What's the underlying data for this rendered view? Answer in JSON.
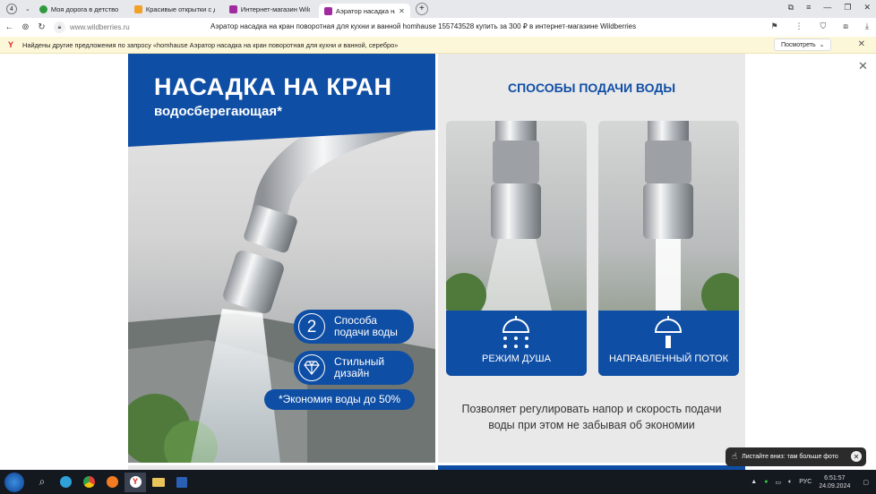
{
  "colors": {
    "brand_blue": "#0f4ea5",
    "tab_bg": "#e7e8ec",
    "info_bg": "#fdf7d9",
    "taskbar_bg": "#14181f"
  },
  "tabs": {
    "count": "4",
    "items": [
      {
        "label": "Моя дорога в детство - С",
        "icon": "tab-favicon-green",
        "color": "#2e9a3e",
        "active": false
      },
      {
        "label": "Красивые открытки с доб",
        "icon": "tab-favicon-orange",
        "color": "#f1a028",
        "active": false
      },
      {
        "label": "Интернет-магазин Wildb",
        "icon": "tab-favicon-wb",
        "color": "#a12a9f",
        "active": false
      },
      {
        "label": "Аэратор насадка на кра",
        "icon": "tab-favicon-wb",
        "color": "#a12a9f",
        "active": true
      }
    ],
    "new_tab": "+"
  },
  "address": {
    "domain": "www.wildberries.ru",
    "page_title": "Аэратор насадка на кран поворотная для кухни и ванной homhause 155743528 купить за 300 ₽ в интернет-магазине Wildberries"
  },
  "infobar": {
    "logo": "Y",
    "text": "Найдены другие предложения по запросу «homhause Аэратор насадка на кран поворотная для кухни и ванной, серебро»",
    "button": "Посмотреть"
  },
  "product_left": {
    "title": "НАСАДКА НА КРАН",
    "subtitle": "водосберегающая*",
    "pill1_number": "2",
    "pill1_text": "Способа\nподачи воды",
    "pill2_text": "Стильный\nдизайн",
    "pill3_text": "*Экономия воды до 50%"
  },
  "product_right": {
    "title": "СПОСОБЫ ПОДАЧИ ВОДЫ",
    "card1_label": "РЕЖИМ ДУША",
    "card2_label": "НАПРАВЛЕННЫЙ ПОТОК",
    "caption": "Позволяет регулировать напор и скорость подачи воды при этом не забывая об экономии"
  },
  "toast": {
    "text": "Листайте вниз: там больше фото"
  },
  "taskbar": {
    "lang": "РУС",
    "time": "6:51:57",
    "date": "24.09.2024"
  }
}
